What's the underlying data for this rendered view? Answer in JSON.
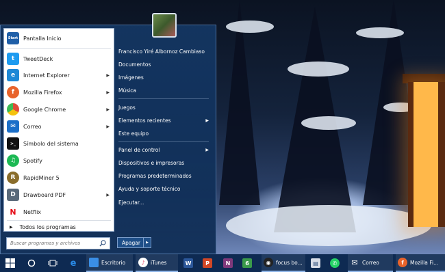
{
  "start_menu": {
    "programs": [
      {
        "label": "Pantalla Inicio",
        "icon": "start-screen-icon",
        "color": "#1f5fa8",
        "glyph": "Start",
        "has_submenu": false
      },
      {
        "label": "TweetDeck",
        "icon": "tweetdeck-icon",
        "color": "#1d9bf0",
        "glyph": "t",
        "has_submenu": false
      },
      {
        "label": "Internet Explorer",
        "icon": "internet-explorer-icon",
        "color": "#1e88d6",
        "glyph": "e",
        "has_submenu": true
      },
      {
        "label": "Mozilla Firefox",
        "icon": "firefox-icon",
        "color": "#e8632b",
        "glyph": "f",
        "has_submenu": true
      },
      {
        "label": "Google Chrome",
        "icon": "chrome-icon",
        "color": "#dd4b39",
        "glyph": "c",
        "has_submenu": true
      },
      {
        "label": "Correo",
        "icon": "mail-icon",
        "color": "#1b6fc8",
        "glyph": "✉",
        "has_submenu": true
      },
      {
        "label": "Símbolo del sistema",
        "icon": "command-prompt-icon",
        "color": "#111111",
        "glyph": ">_",
        "has_submenu": false
      },
      {
        "label": "Spotify",
        "icon": "spotify-icon",
        "color": "#1db954",
        "glyph": "♫",
        "has_submenu": false
      },
      {
        "label": "RapidMiner 5",
        "icon": "rapidminer-icon",
        "color": "#8a6d2b",
        "glyph": "R",
        "has_submenu": false
      },
      {
        "label": "Drawboard PDF",
        "icon": "drawboard-pdf-icon",
        "color": "#5a6a7a",
        "glyph": "D",
        "has_submenu": true
      },
      {
        "label": "Netflix",
        "icon": "netflix-icon",
        "color": "#ffffff",
        "glyph": "N",
        "has_submenu": false
      }
    ],
    "all_programs": "Todos los programas",
    "search_placeholder": "Buscar programas y archivos",
    "right_items": [
      {
        "label": "Francisco Yiré Albornoz Cambiaso",
        "has_submenu": false
      },
      {
        "label": "Documentos",
        "has_submenu": false
      },
      {
        "label": "Imágenes",
        "has_submenu": false
      },
      {
        "label": "Música",
        "has_submenu": false
      },
      {
        "label": "Juegos",
        "has_submenu": false
      },
      {
        "label": "Elementos recientes",
        "has_submenu": true
      },
      {
        "label": "Este equipo",
        "has_submenu": false
      },
      {
        "label": "Panel de control",
        "has_submenu": true
      },
      {
        "label": "Dispositivos e impresoras",
        "has_submenu": false
      },
      {
        "label": "Programas predeterminados",
        "has_submenu": false
      },
      {
        "label": "Ayuda y soporte técnico",
        "has_submenu": false
      },
      {
        "label": "Ejecutar...",
        "has_submenu": false
      }
    ],
    "shutdown_label": "Apagar"
  },
  "taskbar": {
    "items": [
      {
        "label": "",
        "icon": "windows-start-icon"
      },
      {
        "label": "",
        "icon": "cortana-circle-icon"
      },
      {
        "label": "",
        "icon": "task-view-icon"
      },
      {
        "label": "",
        "icon": "edge-icon"
      },
      {
        "label": "Escritorio",
        "icon": "desktop-icon"
      },
      {
        "label": "iTunes",
        "icon": "itunes-icon"
      },
      {
        "label": "",
        "icon": "word-icon"
      },
      {
        "label": "",
        "icon": "powerpoint-icon"
      },
      {
        "label": "",
        "icon": "onenote-icon"
      },
      {
        "label": "",
        "icon": "app-6-icon"
      },
      {
        "label": "focus bo...",
        "icon": "focus-icon"
      },
      {
        "label": "",
        "icon": "document-viewer-icon"
      },
      {
        "label": "",
        "icon": "whatsapp-icon"
      },
      {
        "label": "Correo",
        "icon": "mail-icon"
      },
      {
        "label": "Mozilla Fi...",
        "icon": "firefox-icon"
      }
    ]
  },
  "colors": {
    "taskbar": "#0e2a52",
    "menu_right_pane": "#163a66",
    "accent": "#1f5fa8"
  }
}
